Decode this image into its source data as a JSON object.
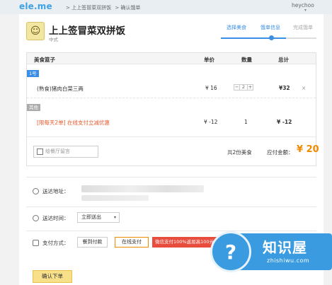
{
  "topbar": {
    "logo": "ele.me",
    "crumbs": [
      "> 上上签冒菜双拼饭",
      "> 确认饿单"
    ],
    "user": "heychoo",
    "user_caret": "▾"
  },
  "restaurant": {
    "name": "上上签冒菜双拼饭",
    "category": "中式"
  },
  "steps": {
    "items": [
      {
        "label": "选择美食",
        "state": "done"
      },
      {
        "label": "饿单信息",
        "state": "current"
      },
      {
        "label": "完成饿单",
        "state": "todo"
      }
    ],
    "accent": "#3a8ee6"
  },
  "cart": {
    "headers": {
      "name": "美食篮子",
      "price": "单价",
      "qty": "数量",
      "total": "总计"
    },
    "groups": [
      {
        "tag": "1号",
        "items": [
          {
            "name": "(熟食)猪肉白菜三两",
            "price": "¥ 16",
            "qty": "2",
            "total": "¥32",
            "remove": "×"
          }
        ]
      },
      {
        "tag": "其他",
        "items": [
          {
            "name": "[限每天2单] 在线支付立减优惠",
            "price": "¥ -12",
            "qty": "1",
            "total": "¥ -12"
          }
        ]
      }
    ],
    "stepper": {
      "minus": "−",
      "plus": "+"
    },
    "remark_placeholder": "给餐厅留言",
    "summary": "共2份美食",
    "total_label": "应付金额：",
    "total_value": "¥ 20"
  },
  "delivery": {
    "address_label": "送达地址：",
    "time_label": "送达时间：",
    "time_value": "立即送出",
    "time_caret": "▾"
  },
  "payment": {
    "label": "支付方式：",
    "options": [
      "餐到付款",
      "在线支付"
    ],
    "selected": "在线支付",
    "promo": "微信支付100%返屈高100元"
  },
  "submit_label": "确认下单",
  "watermark": {
    "title": "知识屋",
    "sub": "zhishiwu.com",
    "glyph": "?"
  },
  "colors": {
    "accent": "#3a8ee6",
    "orange": "#f08a00",
    "promo_red": "#e84c3d",
    "submit_bg": "#f8e08a"
  }
}
